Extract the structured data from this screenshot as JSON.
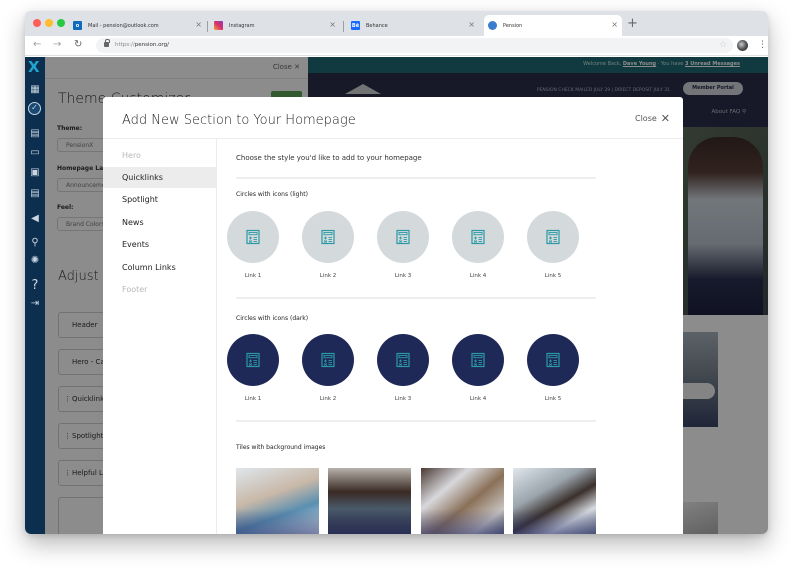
{
  "browser": {
    "tabs": [
      {
        "title": "Mail - pension@outlook.com",
        "favicon": "outlook-icon",
        "active": false
      },
      {
        "title": "Instagram",
        "favicon": "instagram-icon",
        "active": false
      },
      {
        "title": "Behance",
        "favicon": "behance-icon",
        "active": false
      },
      {
        "title": "Pension",
        "favicon": "pension-icon",
        "active": true
      }
    ],
    "url_protocol": "https://",
    "url_host": "pension.org/",
    "new_tab": "+",
    "close_glyph": "×"
  },
  "sidebar": {
    "logo": "X",
    "icons": [
      "calendar-icon",
      "check-circle-icon",
      "layout-icon",
      "folder-icon",
      "chat-icon",
      "invoice-icon",
      "megaphone-icon",
      "user-lock-icon",
      "gear-icon",
      "help-icon",
      "logout-icon"
    ],
    "glyphs": [
      "▦",
      "✓",
      "▤",
      "▭",
      "▣",
      "▤",
      "◀",
      "⚲",
      "✺",
      "?",
      "⇥"
    ]
  },
  "admin_panel": {
    "close_label": "Close ✕",
    "title": "Theme Customizer",
    "theme_label": "Theme:",
    "theme_value": "PensionX",
    "homepage_label": "Homepage Layout:",
    "homepage_value": "Announcements",
    "feel_label": "Feel:",
    "feel_value": "Brand Colors",
    "adjust_title": "Adjust Sections",
    "sections": [
      "Header",
      "Hero - Carousel",
      "Quicklinks",
      "Spotlight",
      "Helpful Links"
    ],
    "drag_glyph": "⋮"
  },
  "website": {
    "welcome_prefix": "Welcome Back,",
    "user_name": "Dave Young",
    "welcome_mid": "· You have",
    "messages_link": "3 Unread Messages",
    "checks_text": "PENSION CHECK MAILED JULY 29  |  DIRECT DEPOSIT JULY 31",
    "portal_button": "Member Portal",
    "nav_text": "About   FAQ   ⚲"
  },
  "modal": {
    "title": "Add New Section to Your Homepage",
    "close_label": "Close",
    "close_glyph": "✕",
    "nav": [
      {
        "label": "Hero",
        "state": "disabled"
      },
      {
        "label": "Quicklinks",
        "state": "active"
      },
      {
        "label": "Spotlight",
        "state": "normal"
      },
      {
        "label": "News",
        "state": "normal"
      },
      {
        "label": "Events",
        "state": "normal"
      },
      {
        "label": "Column Links",
        "state": "normal"
      },
      {
        "label": "Footer",
        "state": "disabled"
      }
    ],
    "intro": "Choose the style you'd like to add to your homepage",
    "styles": [
      {
        "title": "Circles with icons (light)",
        "links": [
          "Link 1",
          "Link 2",
          "Link 3",
          "Link 4",
          "Link 5"
        ]
      },
      {
        "title": "Circles with icons (dark)",
        "links": [
          "Link 1",
          "Link 2",
          "Link 3",
          "Link 4",
          "Link 5"
        ]
      },
      {
        "title": "Tiles with background images"
      }
    ],
    "tiles": [
      "woman-smiling-photo",
      "man-laptop-photo",
      "team-meeting-photo",
      "woman-phone-photo"
    ]
  },
  "colors": {
    "sidebar_bg": "#0d2f4f",
    "accent_teal": "#1fa5d0",
    "icon_teal": "#2a9aa5",
    "dark_circle": "#1f2958",
    "light_circle": "#d4d9dc",
    "site_topbar": "#1e6b74",
    "site_header": "#2b2d4a",
    "publish_green": "#5ea35a"
  }
}
